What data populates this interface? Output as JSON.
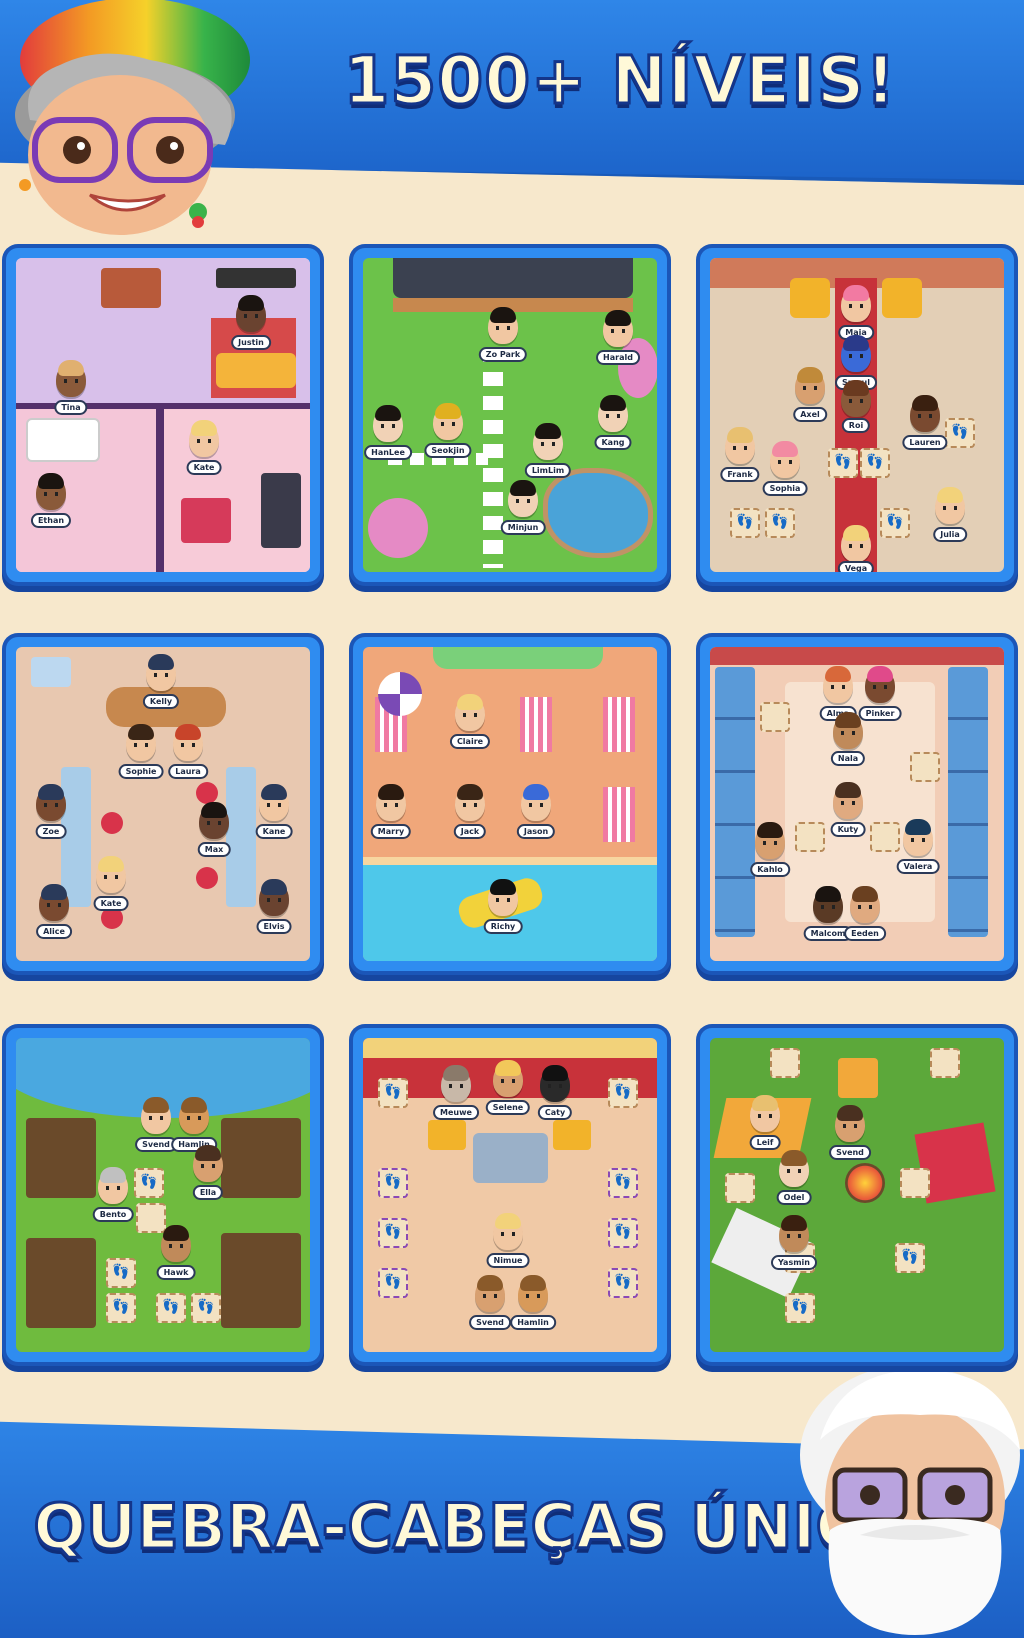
{
  "headline": "1500+ NÍVEIS!",
  "footline": "QUEBRA-CABEÇAS ÚNICOS!",
  "colors": {
    "banner": "#2378e0",
    "background": "#f7e8cc",
    "text_fill": "#fff9d8",
    "text_outline": "#14358a"
  },
  "avatars": {
    "top": "grandma-avatar",
    "bottom": "grandpa-avatar"
  },
  "levels": [
    {
      "theme": "apartment",
      "characters": [
        "Justin",
        "Tina",
        "Kate",
        "Ethan"
      ]
    },
    {
      "theme": "garden",
      "characters": [
        "Zo Park",
        "Harald",
        "HanLee",
        "Seokjin",
        "Kang",
        "LimLim",
        "Minjun"
      ]
    },
    {
      "theme": "temple",
      "characters": [
        "Maia",
        "Smaul",
        "Axel",
        "Roi",
        "Lauren",
        "Frank",
        "Sophia",
        "Julia",
        "Vega"
      ]
    },
    {
      "theme": "police-office",
      "characters": [
        "Kelly",
        "Sophie",
        "Laura",
        "Zoe",
        "Max",
        "Kane",
        "Kate",
        "Alice",
        "Elvis"
      ]
    },
    {
      "theme": "pool",
      "characters": [
        "Claire",
        "Marry",
        "Jack",
        "Jason",
        "Richy"
      ]
    },
    {
      "theme": "classroom",
      "characters": [
        "Alma",
        "Pinker",
        "Nala",
        "Kuty",
        "Kahlo",
        "Valera",
        "Malcom",
        "Eeden"
      ]
    },
    {
      "theme": "village",
      "characters": [
        "Svend",
        "Hamlin",
        "Ella",
        "Bento",
        "Hawk"
      ]
    },
    {
      "theme": "throne-hall",
      "characters": [
        "Meuwe",
        "Selene",
        "Caty",
        "Nimue",
        "Svend",
        "Hamlin"
      ]
    },
    {
      "theme": "campsite",
      "characters": [
        "Leif",
        "Svend",
        "Odel",
        "Yasmin"
      ]
    }
  ]
}
